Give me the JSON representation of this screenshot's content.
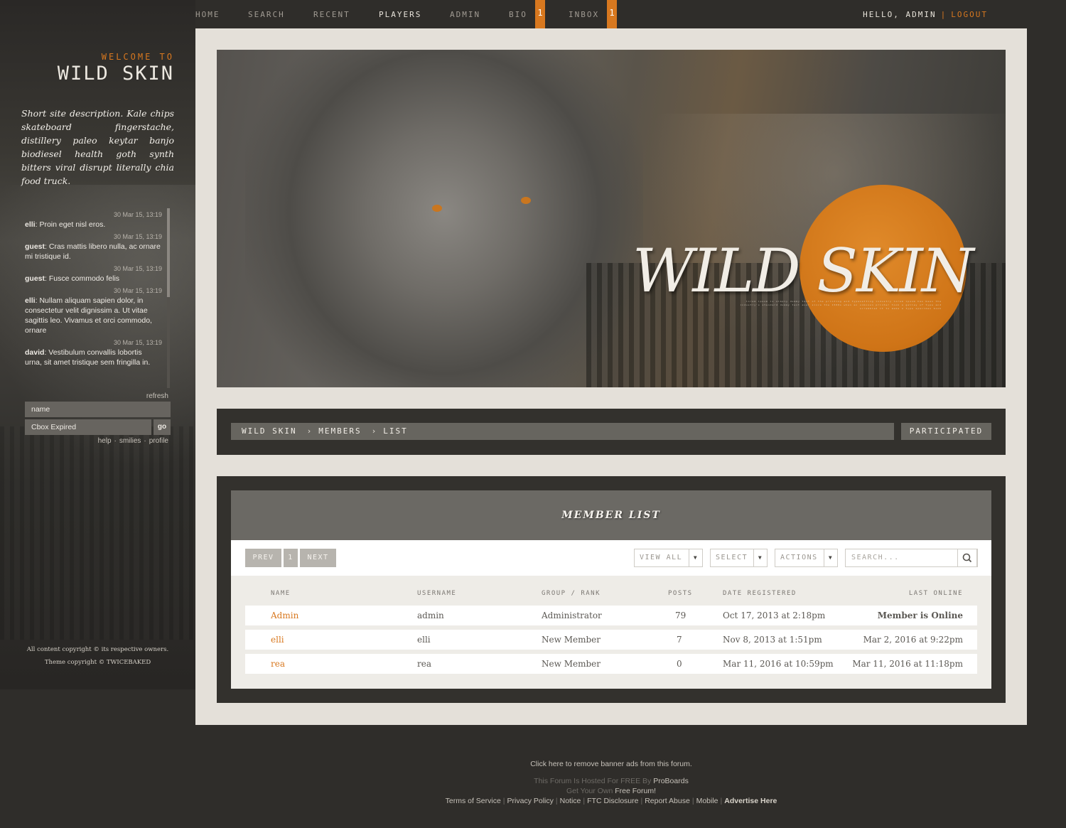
{
  "nav": {
    "items": [
      "HOME",
      "SEARCH",
      "RECENT",
      "PLAYERS",
      "ADMIN",
      "BIO",
      "INBOX"
    ],
    "active": "PLAYERS",
    "bio_badge": "1",
    "inbox_badge": "1",
    "hello": "HELLO, ADMIN",
    "separator": "|",
    "logout": "LOGOUT"
  },
  "sidebar": {
    "welcome_to": "WELCOME TO",
    "site_name": "WILD SKIN",
    "description": "Short site description. Kale chips skateboard fingerstache, distillery paleo keytar banjo biodiesel health goth synth bitters viral disrupt literally chia food truck.",
    "cbox": {
      "messages": [
        {
          "time": "30 Mar 15, 13:19",
          "user": "elli",
          "text": "Proin eget nisl eros."
        },
        {
          "time": "30 Mar 15, 13:19",
          "user": "guest",
          "text": "Cras mattis libero nulla, ac ornare mi tristique id."
        },
        {
          "time": "30 Mar 15, 13:19",
          "user": "guest",
          "text": "Fusce commodo felis"
        },
        {
          "time": "30 Mar 15, 13:19",
          "user": "elli",
          "text": "Nullam aliquam sapien dolor, in consectetur velit dignissim a. Ut vitae sagittis leo. Vivamus et orci commodo, ornare"
        },
        {
          "time": "30 Mar 15, 13:19",
          "user": "david",
          "text": "Vestibulum convallis lobortis urna, sit amet tristique sem fringilla in."
        }
      ],
      "refresh": "refresh",
      "name_value": "name",
      "message_value": "Cbox Expired",
      "go": "go",
      "links": [
        "help",
        "smilies",
        "profile"
      ]
    },
    "copyright_1": "All content copyright © its respective owners.",
    "copyright_2": "Theme copyright © TWICEBAKED"
  },
  "banner": {
    "title": "WILD SKIN",
    "tagline": "lorem ipsum is simply dummy text of the printing and typesetting industry lorem ipsum has been the industry's standard dummy text ever since the 1500s when an unknown printer took a galley of type and scrambled it to make a type specimen book"
  },
  "breadcrumb": {
    "items": [
      "WILD SKIN",
      "MEMBERS",
      "LIST"
    ],
    "separator": "›",
    "participated": "PARTICIPATED"
  },
  "member_list": {
    "title": "MEMBER LIST",
    "prev": "PREV",
    "page": "1",
    "next": "NEXT",
    "view_all": "VIEW ALL",
    "select": "SELECT",
    "actions": "ACTIONS",
    "search_placeholder": "SEARCH...",
    "columns": [
      "NAME",
      "USERNAME",
      "GROUP / RANK",
      "POSTS",
      "DATE REGISTERED",
      "LAST ONLINE"
    ],
    "rows": [
      {
        "name": "Admin",
        "username": "admin",
        "group": "Administrator",
        "posts": "79",
        "registered": "Oct 17, 2013 at 2:18pm",
        "last_online": "Member is Online"
      },
      {
        "name": "elli",
        "username": "elli",
        "group": "New Member",
        "posts": "7",
        "registered": "Nov 8, 2013 at 1:51pm",
        "last_online": "Mar 2, 2016 at 9:22pm"
      },
      {
        "name": "rea",
        "username": "rea",
        "group": "New Member",
        "posts": "0",
        "registered": "Mar 11, 2016 at 10:59pm",
        "last_online": "Mar 11, 2016 at 11:18pm"
      }
    ]
  },
  "footer": {
    "remove_ads": "Click here to remove banner ads from this forum.",
    "hosted": "This Forum Is Hosted For FREE By",
    "proboards": "ProBoards",
    "get_own": "Get Your Own",
    "free_forum": "Free Forum!",
    "links": [
      "Terms of Service",
      "Privacy Policy",
      "Notice",
      "FTC Disclosure",
      "Report Abuse",
      "Mobile"
    ],
    "advertise": "Advertise Here"
  },
  "colors": {
    "accent": "#d8781f",
    "panel_dark": "#33312d",
    "panel_light": "#e4e0d9"
  }
}
